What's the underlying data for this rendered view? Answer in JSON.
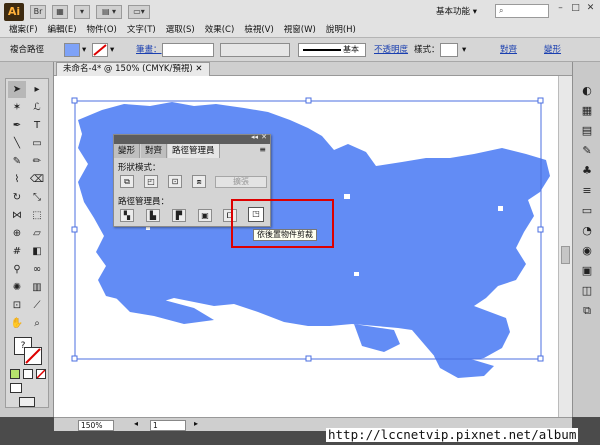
{
  "app": {
    "logo": "Ai",
    "workspace": "基本功能",
    "workspace_arrow": "▾"
  },
  "menus": [
    "檔案(F)",
    "編輯(E)",
    "物件(O)",
    "文字(T)",
    "選取(S)",
    "效果(C)",
    "檢視(V)",
    "視窗(W)",
    "說明(H)"
  ],
  "control_bar": {
    "selection_label": "複合路徑",
    "stroke_label": "筆畫：",
    "stroke_style": "基本",
    "opacity_label": "不透明度",
    "style_label": "樣式：",
    "align_label": "對齊",
    "transform_label": "變形"
  },
  "document_tab": "未命名-4* @ 150% (CMYK/預視)",
  "pathfinder_panel": {
    "tabs": [
      "變形",
      "對齊",
      "路徑管理員"
    ],
    "active_tab": "路徑管理員",
    "shape_modes_label": "形狀模式：",
    "expand_label": "擴張",
    "pathfinders_label": "路徑管理員：",
    "tooltip": "依後置物件剪裁"
  },
  "status": {
    "zoom": "150%",
    "page": "1"
  },
  "watermark": "http://lccnetvip.pixnet.net/album",
  "colors": {
    "shape_fill": "#628cf5",
    "highlight": "#dd0000"
  }
}
